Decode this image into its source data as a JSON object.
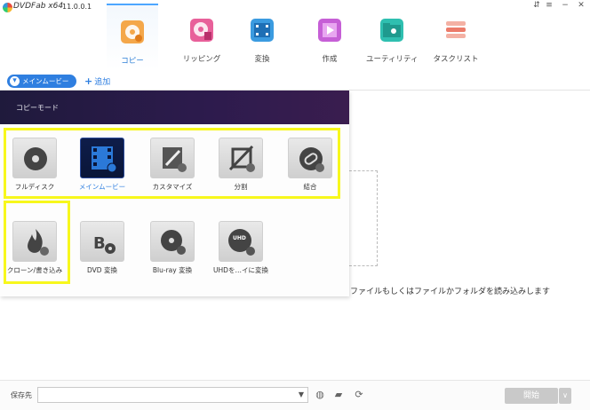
{
  "app": {
    "name": "DVDFab x64",
    "version": "11.0.0.1"
  },
  "window_controls": {
    "pin": "⇵",
    "settings": "≡",
    "minimize": "−",
    "close": "✕"
  },
  "topnav": {
    "items": [
      {
        "label": "コピー",
        "icon": "copy-disc-icon",
        "active": true,
        "color": "#f4a74a"
      },
      {
        "label": "リッピング",
        "icon": "ripper-icon",
        "active": false,
        "color": "#e8609a"
      },
      {
        "label": "変換",
        "icon": "converter-icon",
        "active": false,
        "color": "#3b9be0"
      },
      {
        "label": "作成",
        "icon": "creator-icon",
        "active": false,
        "color": "#c65fd6"
      },
      {
        "label": "ユーティリティ",
        "icon": "utility-icon",
        "active": false,
        "color": "#2fbfb0"
      },
      {
        "label": "タスクリスト",
        "icon": "tasklist-icon",
        "active": false,
        "color": "#ec7b6a"
      }
    ]
  },
  "subbar": {
    "mode_label": "メインムービー",
    "add_label": "追加"
  },
  "panel": {
    "title": "コピーモード",
    "tiles": [
      {
        "label": "フルディスク",
        "icon": "full-disc-icon",
        "selected": false
      },
      {
        "label": "メインムービー",
        "icon": "main-movie-icon",
        "selected": true
      },
      {
        "label": "カスタマイズ",
        "icon": "customize-icon",
        "selected": false
      },
      {
        "label": "分割",
        "icon": "split-icon",
        "selected": false
      },
      {
        "label": "結合",
        "icon": "merge-icon",
        "selected": false
      },
      {
        "label": "クローン/書き込み",
        "icon": "clone-burn-icon",
        "selected": false
      },
      {
        "label": "DVD 変換",
        "icon": "dvd-convert-icon",
        "selected": false
      },
      {
        "label": "Blu-ray 変換",
        "icon": "bluray-convert-icon",
        "selected": false
      },
      {
        "label": "UHDを…イに変換",
        "icon": "uhd-convert-icon",
        "selected": false
      }
    ]
  },
  "main": {
    "drop_hint": "ファイルもしくはファイルかフォルダを読み込みします"
  },
  "bottombar": {
    "save_label": "保存先",
    "save_path": "",
    "start_label": "開始",
    "start_drop": "∨"
  },
  "colors": {
    "accent": "#2f7fe0",
    "highlight": "#f7f71c",
    "panel_header": "#2d1b4d"
  }
}
